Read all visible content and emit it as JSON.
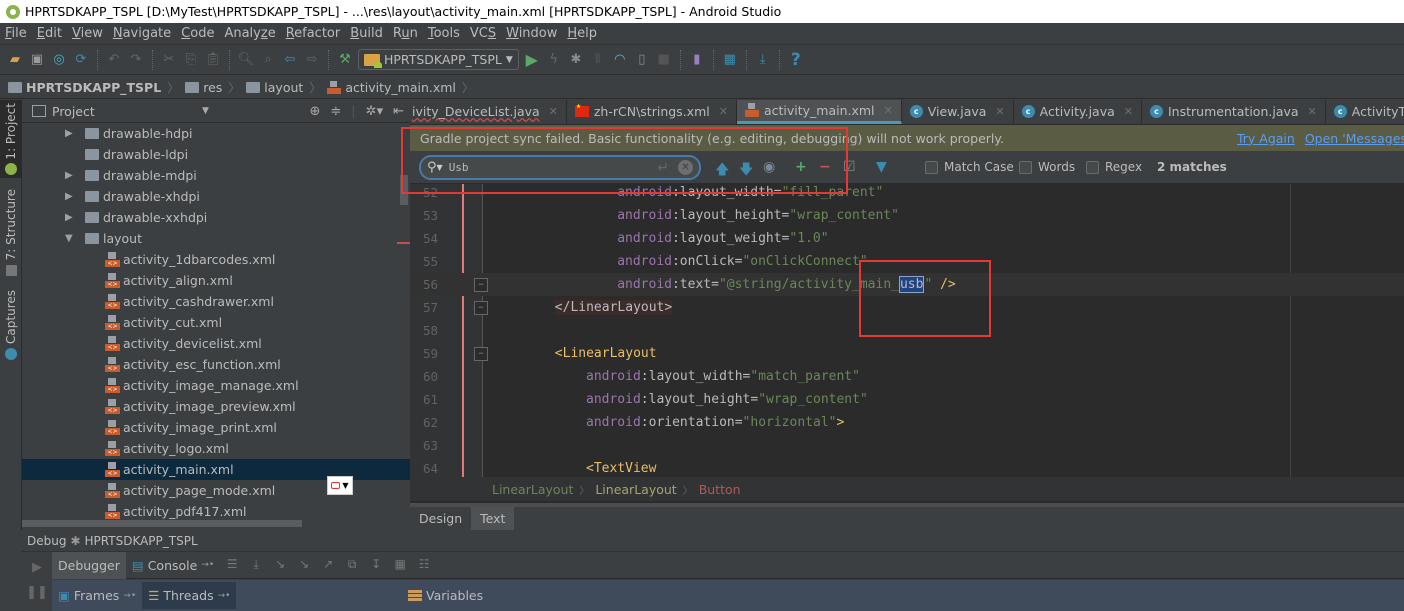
{
  "window": {
    "title": "HPRTSDKAPP_TSPL [D:\\MyTest\\HPRTSDKAPP_TSPL] - ...\\res\\layout\\activity_main.xml [HPRTSDKAPP_TSPL] - Android Studio"
  },
  "menu": [
    {
      "label": "File",
      "mn": "F"
    },
    {
      "label": "Edit",
      "mn": "E"
    },
    {
      "label": "View",
      "mn": "V"
    },
    {
      "label": "Navigate",
      "mn": "N"
    },
    {
      "label": "Code",
      "mn": "C"
    },
    {
      "label": "Analyze",
      "mn": "z"
    },
    {
      "label": "Refactor",
      "mn": "R"
    },
    {
      "label": "Build",
      "mn": "B"
    },
    {
      "label": "Run",
      "mn": "u"
    },
    {
      "label": "Tools",
      "mn": "T"
    },
    {
      "label": "VCS",
      "mn": "S"
    },
    {
      "label": "Window",
      "mn": "W"
    },
    {
      "label": "Help",
      "mn": "H"
    }
  ],
  "toolbar": {
    "run_config": "HPRTSDKAPP_TSPL"
  },
  "breadcrumb": [
    "HPRTSDKAPP_TSPL",
    "res",
    "layout",
    "activity_main.xml"
  ],
  "left_strip": {
    "project": "1: Project",
    "structure": "7: Structure",
    "captures": "Captures"
  },
  "project_panel": {
    "title": "Project",
    "tree": [
      {
        "label": "drawable-hdpi",
        "type": "folder",
        "expandable": true
      },
      {
        "label": "drawable-ldpi",
        "type": "folder",
        "expandable": false
      },
      {
        "label": "drawable-mdpi",
        "type": "folder",
        "expandable": true
      },
      {
        "label": "drawable-xhdpi",
        "type": "folder",
        "expandable": true
      },
      {
        "label": "drawable-xxhdpi",
        "type": "folder",
        "expandable": true
      },
      {
        "label": "layout",
        "type": "folder",
        "expanded": true
      },
      {
        "label": "activity_1dbarcodes.xml",
        "type": "xml"
      },
      {
        "label": "activity_align.xml",
        "type": "xml"
      },
      {
        "label": "activity_cashdrawer.xml",
        "type": "xml"
      },
      {
        "label": "activity_cut.xml",
        "type": "xml"
      },
      {
        "label": "activity_devicelist.xml",
        "type": "xml"
      },
      {
        "label": "activity_esc_function.xml",
        "type": "xml"
      },
      {
        "label": "activity_image_manage.xml",
        "type": "xml"
      },
      {
        "label": "activity_image_preview.xml",
        "type": "xml"
      },
      {
        "label": "activity_image_print.xml",
        "type": "xml"
      },
      {
        "label": "activity_logo.xml",
        "type": "xml"
      },
      {
        "label": "activity_main.xml",
        "type": "xml",
        "selected": true
      },
      {
        "label": "activity_page_mode.xml",
        "type": "xml"
      },
      {
        "label": "activity_pdf417.xml",
        "type": "xml"
      }
    ]
  },
  "editor_tabs": [
    {
      "label": "ivity_DeviceList.java",
      "icon": "java",
      "active": false
    },
    {
      "label": "zh-rCN\\strings.xml",
      "icon": "flag-cn",
      "active": false
    },
    {
      "label": "activity_main.xml",
      "icon": "xml",
      "active": true
    },
    {
      "label": "View.java",
      "icon": "class",
      "active": false
    },
    {
      "label": "Activity.java",
      "icon": "class",
      "active": false
    },
    {
      "label": "Instrumentation.java",
      "icon": "class",
      "active": false
    },
    {
      "label": "ActivityThread.java",
      "icon": "class-run",
      "active": false
    }
  ],
  "banner": {
    "message": "Gradle project sync failed. Basic functionality (e.g. editing, debugging) will not work properly.",
    "try_again": "Try Again",
    "open_messages": "Open 'Messages' View"
  },
  "find": {
    "query": "Usb",
    "match_case": "Match Case",
    "words": "Words",
    "regex": "Regex",
    "match_count": "2 matches"
  },
  "code_lines": [
    {
      "n": "52",
      "indent": 7,
      "parts": [
        [
          "ns",
          "android"
        ],
        [
          "attr",
          ":layout_width="
        ],
        [
          "str",
          "\"fill_parent\""
        ]
      ]
    },
    {
      "n": "53",
      "indent": 7,
      "parts": [
        [
          "ns",
          "android"
        ],
        [
          "attr",
          ":layout_height="
        ],
        [
          "str",
          "\"wrap_content\""
        ]
      ]
    },
    {
      "n": "54",
      "indent": 7,
      "parts": [
        [
          "ns",
          "android"
        ],
        [
          "attr",
          ":layout_weight="
        ],
        [
          "str",
          "\"1.0\""
        ]
      ]
    },
    {
      "n": "55",
      "indent": 7,
      "parts": [
        [
          "ns",
          "android"
        ],
        [
          "attr",
          ":onClick="
        ],
        [
          "str",
          "\"onClickConnect\""
        ]
      ]
    },
    {
      "n": "56",
      "indent": 7,
      "current": true,
      "fold": true,
      "parts": [
        [
          "ns",
          "android"
        ],
        [
          "attr",
          ":text="
        ],
        [
          "str",
          "\"@string/activity_main_"
        ],
        [
          "hl",
          "usb"
        ],
        [
          "str",
          "\""
        ],
        [
          "punc",
          " "
        ],
        [
          "tag",
          "/>"
        ]
      ]
    },
    {
      "n": "57",
      "indent": 3,
      "fold": true,
      "parts": [
        [
          "tagbg",
          "</LinearLayout>"
        ]
      ]
    },
    {
      "n": "58",
      "indent": 0,
      "parts": []
    },
    {
      "n": "59",
      "indent": 3,
      "fold": true,
      "parts": [
        [
          "tag",
          "<LinearLayout"
        ]
      ]
    },
    {
      "n": "60",
      "indent": 5,
      "parts": [
        [
          "ns",
          "android"
        ],
        [
          "attr",
          ":layout_width="
        ],
        [
          "str",
          "\"match_parent\""
        ]
      ]
    },
    {
      "n": "61",
      "indent": 5,
      "parts": [
        [
          "ns",
          "android"
        ],
        [
          "attr",
          ":layout_height="
        ],
        [
          "str",
          "\"wrap_content\""
        ]
      ]
    },
    {
      "n": "62",
      "indent": 5,
      "parts": [
        [
          "ns",
          "android"
        ],
        [
          "attr",
          ":orientation="
        ],
        [
          "str",
          "\"horizontal\""
        ],
        [
          "tag",
          ">"
        ]
      ]
    },
    {
      "n": "63",
      "indent": 0,
      "parts": []
    },
    {
      "n": "64",
      "indent": 5,
      "parts": [
        [
          "tag",
          "<TextView"
        ]
      ]
    }
  ],
  "editor_breadcrumb": [
    "LinearLayout",
    "LinearLayout",
    "Button"
  ],
  "design_tabs": {
    "design": "Design",
    "text": "Text"
  },
  "debug": {
    "label": "Debug",
    "config": "HPRTSDKAPP_TSPL",
    "tabs": {
      "debugger": "Debugger",
      "console": "Console"
    },
    "panes": {
      "frames": "Frames",
      "threads": "Threads",
      "variables": "Variables"
    }
  },
  "colors": {
    "banner_bg": "#5b5c44",
    "link": "#589df6",
    "selection": "#0d293e",
    "annotation_red": "#e53935"
  }
}
